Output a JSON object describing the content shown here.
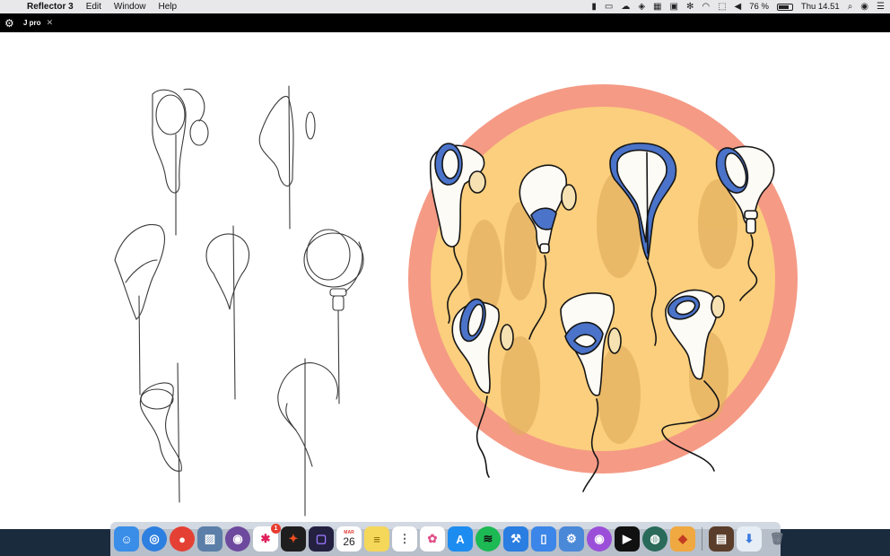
{
  "menubar": {
    "app_name": "Reflector 3",
    "menus": [
      "Edit",
      "Window",
      "Help"
    ],
    "battery_text": "76 %",
    "battery_level": 0.76,
    "clock": "Thu 14.51"
  },
  "window": {
    "tab_title": "J pro"
  },
  "dock": {
    "calendar_month": "MAR",
    "calendar_day": "26",
    "slack_badge": "1"
  },
  "colors": {
    "circle_outer": "#f59a85",
    "circle_inner": "#fbcf7d",
    "accent_blue": "#4a73c9",
    "menubar_bg": "#e8e8ea",
    "tabbar_bg": "#000000"
  }
}
